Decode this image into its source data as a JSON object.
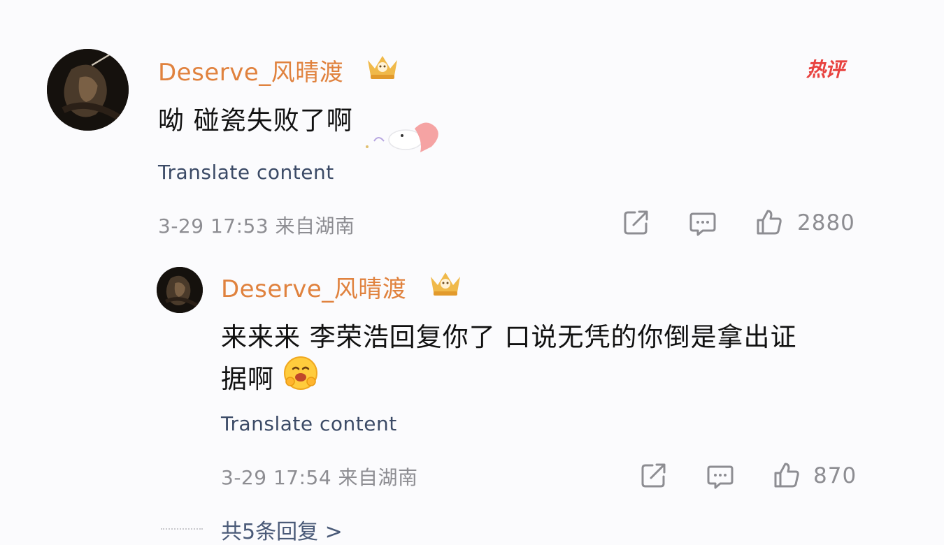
{
  "comments": [
    {
      "username": "Deserve_风晴渡",
      "badge": "hot",
      "badge_label": "热评",
      "text": "呦 碰瓷失败了啊",
      "translate_label": "Translate content",
      "meta": "3-29 17:53 来自湖南",
      "likes": "2880"
    },
    {
      "username": "Deserve_风晴渡",
      "text_line1": "来来来 李荣浩回复你了 口说无凭的你倒是拿出证",
      "text_line2": "据啊",
      "translate_label": "Translate content",
      "meta": "3-29 17:54 来自湖南",
      "likes": "870"
    }
  ],
  "replies_link": "共5条回复 >",
  "colors": {
    "username": "#e0823e",
    "hot_badge": "#e8423f",
    "meta": "#8d8d92",
    "translate": "#3b4a66"
  },
  "icons": [
    "crown-badge-icon",
    "share-icon",
    "comment-icon",
    "like-icon",
    "hug-emoji-icon",
    "sticker-icon"
  ]
}
